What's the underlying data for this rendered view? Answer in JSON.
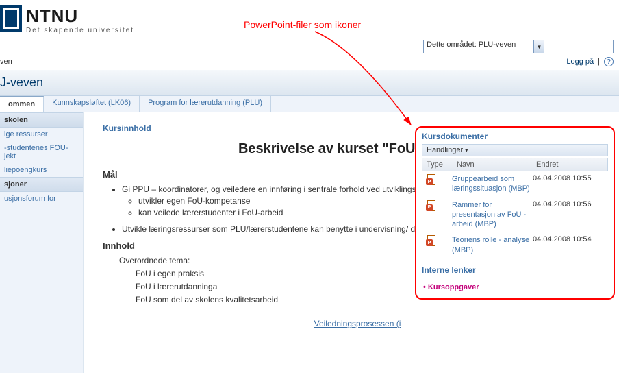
{
  "header": {
    "logo_title": "NTNU",
    "logo_sub": "Det skapende universitet",
    "annotation": "PowerPoint-filer som ikoner",
    "scope_select": "Dette området: PLU-veven"
  },
  "topbar": {
    "left": "ven",
    "login": "Logg på",
    "pipe": "|"
  },
  "banner": {
    "title": "J-veven"
  },
  "tabs": [
    {
      "label": "ommen",
      "active": true
    },
    {
      "label": "Kunnskapsløftet (LK06)",
      "active": false
    },
    {
      "label": "Program for lærerutdanning (PLU)",
      "active": false
    }
  ],
  "sidebar": {
    "groups": [
      {
        "head": "skolen",
        "items": [
          "ige ressurser",
          "-studentenes FOU-jekt",
          "liepoengkurs"
        ]
      },
      {
        "head": "sjoner",
        "items": [
          "usjonsforum for"
        ]
      }
    ]
  },
  "main": {
    "section_title": "Kursinnhold",
    "course_heading": "Beskrivelse av kurset \"FoU i skolen\"",
    "mal_head": "Mål",
    "goal1": "Gi PPU – koordinatorer, og veiledere en innføring i sentrale forhold ved utviklingsarbeid, aksjonslæring og veiledning slik at de :",
    "goal1a": "utvikler egen FoU-kompetanse",
    "goal1b": "kan veilede lærerstudenter i FoU-arbeid",
    "goal2": "Utvikle læringsressurser som PLU/lærerstudentene kan benytte i undervisning/ del av arbeidet med eget FoU-arbeid",
    "innhold_head": "Innhold",
    "over_head": "Overordnede tema:",
    "t1": "FoU i egen praksis",
    "t2": "FoU i lærerutdanninga",
    "t3": "FoU som del av skolens kvalitetsarbeid",
    "bottom_link": "Veiledningsprosessen (i"
  },
  "docs": {
    "title": "Kursdokumenter",
    "toolbar": "Handlinger",
    "col_type": "Type",
    "col_name": "Navn",
    "col_date": "Endret",
    "rows": [
      {
        "name": "Gruppearbeid som læringssituasjon (MBP)",
        "date": "04.04.2008 10:55"
      },
      {
        "name": "Rammer for presentasjon av FoU -arbeid (MBP)",
        "date": "04.04.2008 10:56"
      },
      {
        "name": "Teoriens rolle - analyse (MBP)",
        "date": "04.04.2008 10:54"
      }
    ],
    "interne": "Interne lenker",
    "kursoppgaver": "Kursoppgaver"
  }
}
